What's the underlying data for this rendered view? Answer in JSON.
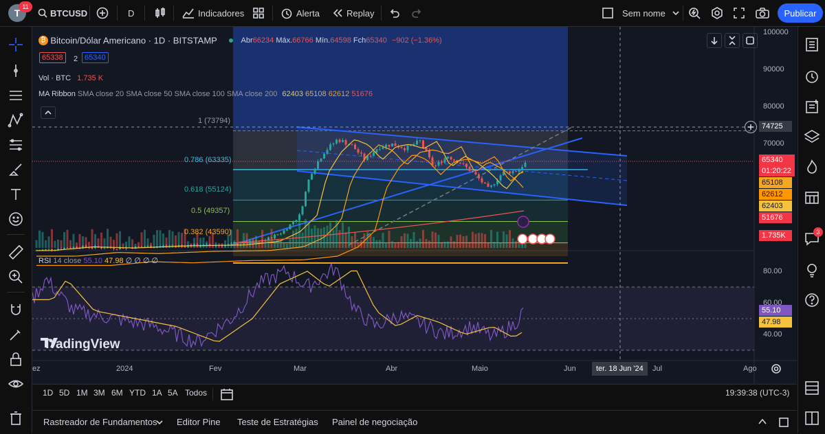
{
  "header": {
    "avatar_letter": "T",
    "notifications": "11",
    "symbol": "BTCUSD",
    "interval": "D",
    "indicators": "Indicadores",
    "alert": "Alerta",
    "replay": "Replay",
    "layout_name": "Sem nome",
    "publish": "Publicar"
  },
  "legend": {
    "title": "Bitcoin/Dólar Americano · 1D · BITSTAMP",
    "open_label": "Abr",
    "open": "66234",
    "high_label": "Máx.",
    "high": "66766",
    "low_label": "Mín.",
    "low": "64598",
    "close_label": "Fch",
    "close": "65340",
    "change": "−902 (−1.36%)",
    "bid": "65338",
    "spread": "2",
    "ask": "65340",
    "vol_label": "Vol · BTC",
    "vol": "1.735 K",
    "ma_label": "MA Ribbon",
    "ma_params": "SMA close 20 SMA close 50 SMA close 100 SMA close 200",
    "ma1": "62403",
    "ma2": "65108",
    "ma3": "62612",
    "ma4": "51676",
    "rsi_label": "RSI",
    "rsi_params": "14 close",
    "rsi_value": "55.10",
    "rsi_ma": "47.98",
    "rsi_extra": "∅ ∅ ∅ ∅"
  },
  "fib": {
    "l1": "1 (73794)",
    "l786": "0.786 (63335)",
    "l618": "0.618 (55124)",
    "l5": "0.5 (49357)",
    "l382": "0.382 (43590)"
  },
  "price_axis": [
    "100000",
    "90000",
    "80000",
    "70000"
  ],
  "rsi_axis": [
    "80.00",
    "60.00",
    "40.00"
  ],
  "price_tags": {
    "crosshair": "74725",
    "last": "65340",
    "countdown": "01:20:22",
    "ma2": "65108",
    "ma3": "62612",
    "ma1": "62403",
    "ma4": "51676",
    "volume": "1.735K",
    "rsi": "55.10",
    "rsi_ma": "47.98"
  },
  "time_axis": [
    "ez",
    "2024",
    "Fev",
    "Mar",
    "Abr",
    "Maio",
    "Jun",
    "Jul",
    "Ago"
  ],
  "time_crosshair": "ter. 18 Jun '24",
  "watermark": "TradingView",
  "periods": [
    "1D",
    "5D",
    "1M",
    "3M",
    "6M",
    "YTD",
    "1A",
    "5A",
    "Todos"
  ],
  "clock": "19:39:38 (UTC-3)",
  "bottom_tabs": [
    "Rastreador de Fundamentos",
    "Editor Pine",
    "Teste de Estratégias",
    "Painel de negociação"
  ],
  "right_panel_badge": "3",
  "colors": {
    "up": "#26a69a",
    "down": "#ef5350",
    "accent": "#2962ff",
    "rsi": "#7e57c2",
    "ma_yellow": "#f5c33b",
    "fib_cyan": "#2bc0e4"
  }
}
